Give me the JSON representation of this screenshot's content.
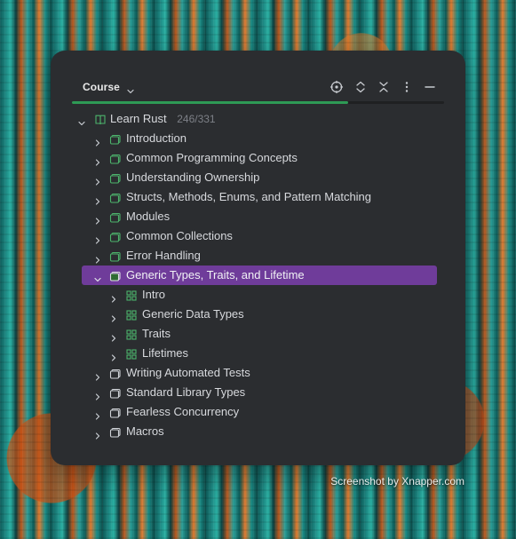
{
  "header": {
    "title": "Course",
    "icons": [
      "locate-icon",
      "expand-collapse-icon",
      "collapse-all-icon",
      "more-icon",
      "minimize-icon"
    ],
    "progress": 0.7432
  },
  "tree": {
    "root": {
      "label": "Learn Rust",
      "count": "246/331"
    },
    "items": [
      {
        "label": "Introduction",
        "state": "complete"
      },
      {
        "label": "Common Programming Concepts",
        "state": "complete"
      },
      {
        "label": "Understanding Ownership",
        "state": "complete"
      },
      {
        "label": "Structs, Methods, Enums, and Pattern Matching",
        "state": "complete"
      },
      {
        "label": "Modules",
        "state": "complete"
      },
      {
        "label": "Common Collections",
        "state": "complete"
      },
      {
        "label": "Error Handling",
        "state": "complete"
      },
      {
        "label": "Generic Types, Traits, and Lifetime",
        "state": "selected"
      },
      {
        "label": "Intro",
        "state": "lesson"
      },
      {
        "label": "Generic Data Types",
        "state": "lesson"
      },
      {
        "label": "Traits",
        "state": "lesson"
      },
      {
        "label": "Lifetimes",
        "state": "lesson"
      },
      {
        "label": "Writing Automated Tests",
        "state": "incomplete"
      },
      {
        "label": "Standard Library Types",
        "state": "incomplete"
      },
      {
        "label": "Fearless Concurrency",
        "state": "incomplete"
      },
      {
        "label": "Macros",
        "state": "incomplete"
      }
    ]
  },
  "watermark": "Screenshot by Xnapper.com",
  "colors": {
    "accent_green": "#2e9a55",
    "selected_purple": "#6f3c9a",
    "panel_bg": "#2b2d30",
    "text_primary": "#d7d9dd",
    "text_muted": "#7d8087"
  }
}
